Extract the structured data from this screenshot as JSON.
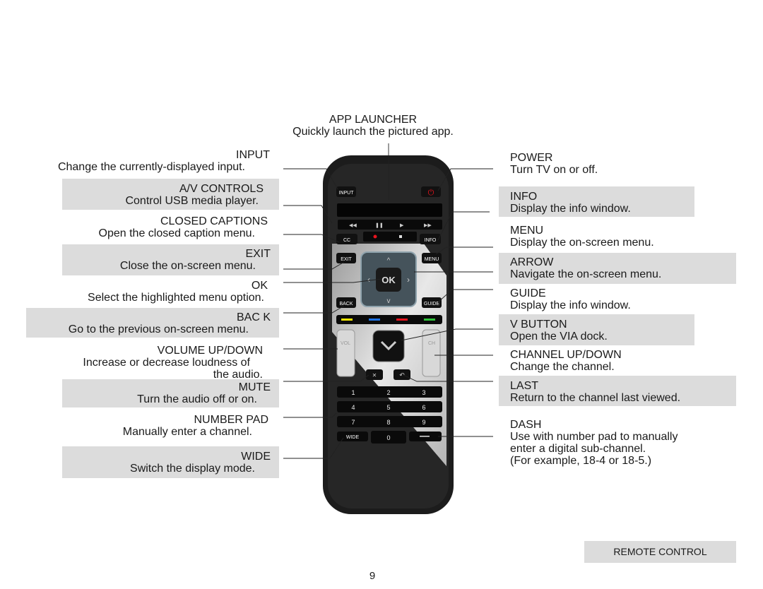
{
  "app_launcher": {
    "title": "APP LAUNCHER",
    "desc": "Quickly launch the pictured app."
  },
  "left": [
    {
      "title": "INPUT",
      "desc": "Change the currently-displayed input."
    },
    {
      "title": "A/V CONTROLS",
      "desc": "Control USB media player."
    },
    {
      "title": "CLOSED CAPTIONS",
      "desc": "Open the closed caption menu."
    },
    {
      "title": "EXIT",
      "desc": "Close the on-screen menu."
    },
    {
      "title": "OK",
      "desc": "Select the highlighted menu option."
    },
    {
      "title": "BAC K",
      "desc": "Go to the previous on-screen menu."
    },
    {
      "title": "VOLUME UP/DOWN",
      "desc": "Increase or decrease loudness of",
      "desc2": "the audio."
    },
    {
      "title": "MUTE",
      "desc": "Turn the audio off or on."
    },
    {
      "title": "NUMBER PAD",
      "desc": "Manually enter a channel."
    },
    {
      "title": "WIDE",
      "desc": "Switch the display mode."
    }
  ],
  "right": [
    {
      "title": "POWER",
      "desc": "Turn TV on or off."
    },
    {
      "title": "INFO",
      "desc": "Display the info window."
    },
    {
      "title": "MENU",
      "desc": "Display the on-screen menu."
    },
    {
      "title": "ARROW",
      "desc": "Navigate the on-screen menu."
    },
    {
      "title": "GUIDE",
      "desc": "Display the info window."
    },
    {
      "title": "V BUTTON",
      "desc": "Open the VIA dock."
    },
    {
      "title": "CHANNEL UP/DOWN",
      "desc": "Change the channel."
    },
    {
      "title": "LAST",
      "desc": "Return to the channel last viewed."
    },
    {
      "title": "DASH",
      "desc": "Use with number pad to manually",
      "desc2": "enter a digital sub-channel.",
      "desc3": "(For example, 18-4 or 18-5.)"
    }
  ],
  "remote": {
    "input": "INPUT",
    "cc": "CC",
    "info": "INFO",
    "exit": "EXIT",
    "menu": "MENU",
    "ok": "OK",
    "back": "BACK",
    "guide": "GUIDE",
    "vol": "VOL",
    "ch": "CH",
    "wide": "WIDE",
    "numbers": [
      "1",
      "2",
      "3",
      "4",
      "5",
      "6",
      "7",
      "8",
      "9",
      "0"
    ],
    "colors": {
      "yellow": "#f2e600",
      "blue": "#1e73e6",
      "red": "#e8141e",
      "green": "#2fc33a",
      "power": "#e8141e"
    }
  },
  "footer": {
    "section": "REMOTE CONTROL",
    "page": "9"
  }
}
